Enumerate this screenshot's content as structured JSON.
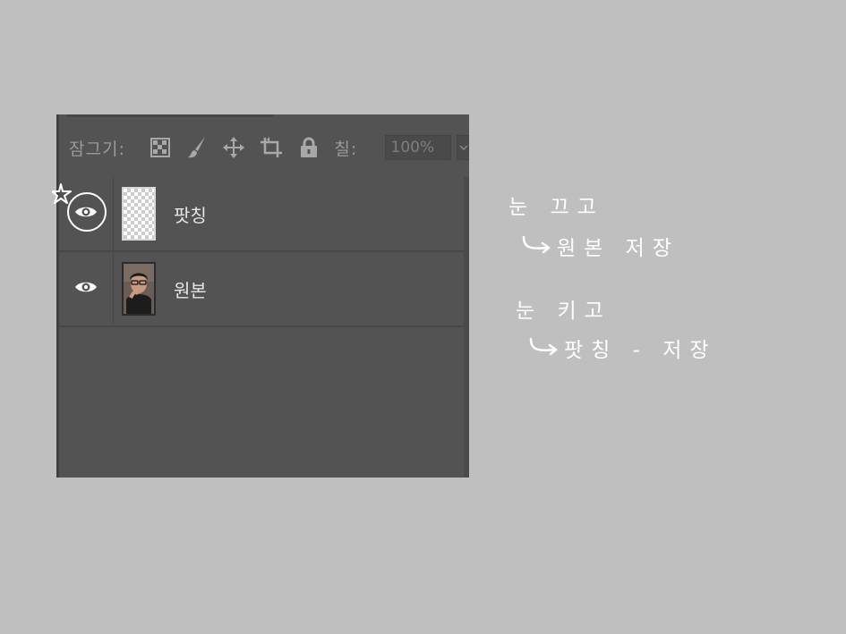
{
  "layers_panel": {
    "lock_label": "잠그기:",
    "lock_icons": [
      "lock-transparent-pixels-icon",
      "lock-image-pixels-icon",
      "lock-position-icon",
      "lock-artboard-icon",
      "lock-all-icon"
    ],
    "fill_label": "칠:",
    "fill_value": "100%",
    "layers": [
      {
        "name": "팟칭",
        "visible": true,
        "thumbnail": "transparent-checkerboard"
      },
      {
        "name": "원본",
        "visible": true,
        "thumbnail": "portrait-photo"
      }
    ]
  },
  "annotations": {
    "note1_line1": "눈 끄고",
    "note1_line2": "원본 저장",
    "note2_line1": "눈 키고",
    "note2_line2": "팟칭 - 저장"
  }
}
